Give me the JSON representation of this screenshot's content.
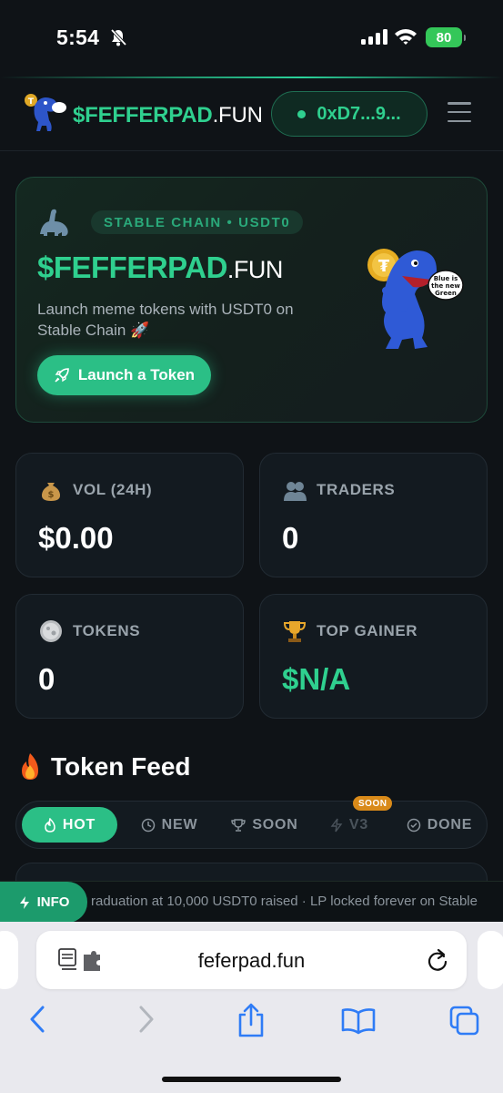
{
  "status_bar": {
    "time": "5:54",
    "battery": "80"
  },
  "header": {
    "brand_bold": "$FEFFERPAD",
    "brand_light": ".FUN",
    "wallet": "0xD7...9..."
  },
  "hero": {
    "chip": "STABLE CHAIN • USDT0",
    "title_bold": "$FEFFERPAD",
    "title_light": ".FUN",
    "subtitle": "Launch meme tokens with USDT0 on Stable Chain 🚀",
    "launch_label": "Launch a Token",
    "mascot_bubble": "Blue is the new Green"
  },
  "stats": [
    {
      "icon": "money-bag-icon",
      "label": "VOL (24H)",
      "value": "$0.00"
    },
    {
      "icon": "people-icon",
      "label": "TRADERS",
      "value": "0"
    },
    {
      "icon": "coin-icon",
      "label": "TOKENS",
      "value": "0"
    },
    {
      "icon": "trophy-icon",
      "label": "TOP GAINER",
      "value": "$N/A"
    }
  ],
  "feed": {
    "title": "Token Feed",
    "tabs": [
      {
        "label": "HOT",
        "icon": "flame-icon",
        "active": true
      },
      {
        "label": "NEW",
        "icon": "clock-icon"
      },
      {
        "label": "SOON",
        "icon": "trophy-icon"
      },
      {
        "label": "V3",
        "icon": "lightning-icon",
        "disabled": true
      },
      {
        "label": "DONE",
        "icon": "check-circle-icon"
      }
    ],
    "v3_badge": "SOON"
  },
  "ticker": {
    "label": "INFO",
    "text": "raduation at 10,000 USDT0 raised · LP locked forever on Stable"
  },
  "browser": {
    "url": "feferpad.fun"
  },
  "colors": {
    "accent": "#2fd08f",
    "button": "#2bbf86",
    "background": "#0f1317",
    "card": "#131a20"
  }
}
